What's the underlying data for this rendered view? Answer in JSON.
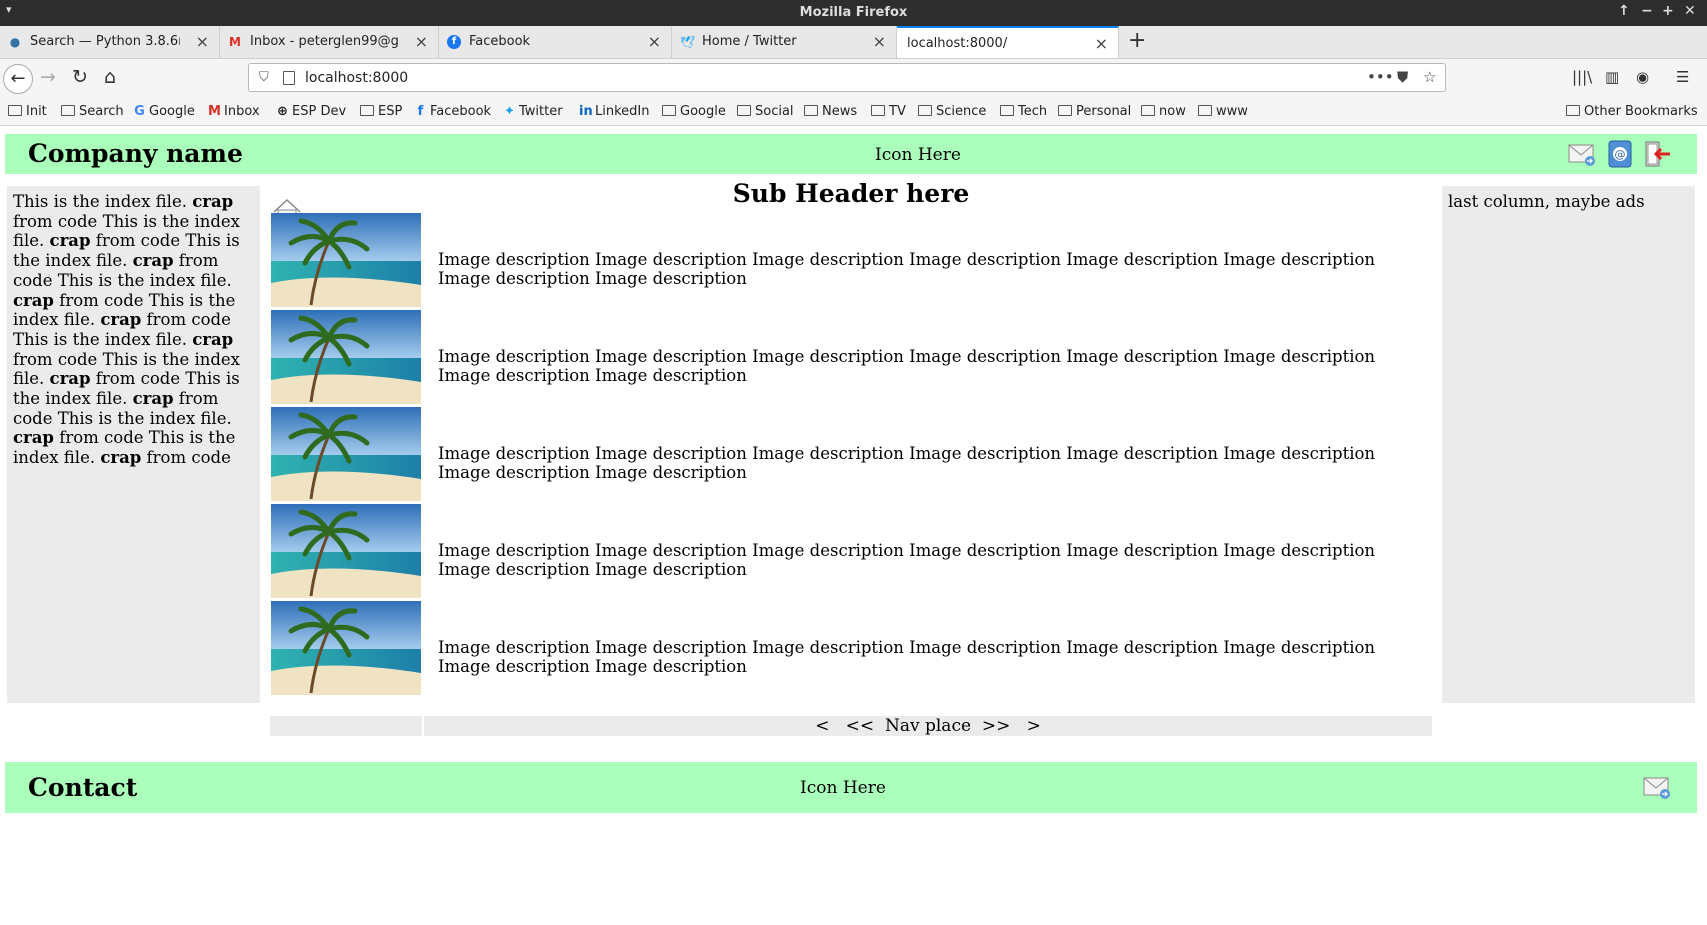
{
  "window": {
    "title": "Mozilla Firefox"
  },
  "tabs": [
    {
      "label": "Search — Python 3.8.6rc1 d",
      "icon": "python-icon",
      "active": false
    },
    {
      "label": "Inbox - peterglen99@gmail",
      "icon": "gmail-icon",
      "active": false
    },
    {
      "label": "Facebook",
      "icon": "facebook-icon",
      "active": false
    },
    {
      "label": "Home / Twitter",
      "icon": "twitter-icon",
      "active": false
    },
    {
      "label": "localhost:8000/",
      "icon": "",
      "active": true
    }
  ],
  "navbar": {
    "url": "localhost:8000"
  },
  "bookmarks": [
    {
      "label": "Init",
      "icon": "folder-icon"
    },
    {
      "label": "Search",
      "icon": "folder-icon"
    },
    {
      "label": "Google",
      "icon": "google-icon"
    },
    {
      "label": "Inbox",
      "icon": "gmail-icon"
    },
    {
      "label": "ESP Dev",
      "icon": "globe-icon"
    },
    {
      "label": "ESP",
      "icon": "folder-icon"
    },
    {
      "label": "Facebook",
      "icon": "facebook-icon"
    },
    {
      "label": "Twitter",
      "icon": "twitter-icon"
    },
    {
      "label": "LinkedIn",
      "icon": "linkedin-icon"
    },
    {
      "label": "Google",
      "icon": "folder-icon"
    },
    {
      "label": "Social",
      "icon": "folder-icon"
    },
    {
      "label": "News",
      "icon": "folder-icon"
    },
    {
      "label": "TV",
      "icon": "folder-icon"
    },
    {
      "label": "Science",
      "icon": "folder-icon"
    },
    {
      "label": "Tech",
      "icon": "folder-icon"
    },
    {
      "label": "Personal",
      "icon": "folder-icon"
    },
    {
      "label": "now",
      "icon": "folder-icon"
    },
    {
      "label": "www",
      "icon": "folder-icon"
    }
  ],
  "other_bookmarks": "Other Bookmarks",
  "page": {
    "header": {
      "company": "Company name",
      "icon_here": "Icon Here"
    },
    "left_text": {
      "normal": "This is the index file. ",
      "bold": "crap",
      "tail": " from code",
      "repeat": 10
    },
    "sub_header": "Sub Header here",
    "rows": [
      {
        "desc": "Image description Image description Image description Image description Image description Image description Image description Image description"
      },
      {
        "desc": "Image description Image description Image description Image description Image description Image description Image description Image description"
      },
      {
        "desc": "Image description Image description Image description Image description Image description Image description Image description Image description"
      },
      {
        "desc": "Image description Image description Image description Image description Image description Image description Image description Image description"
      },
      {
        "desc": "Image description Image description Image description Image description Image description Image description Image description Image description"
      }
    ],
    "nav": {
      "first": "<",
      "prev": "<<",
      "label": "Nav place",
      "next": ">>",
      "last": ">"
    },
    "right_col": "last column, maybe ads",
    "footer": {
      "contact": "Contact",
      "icon_here": "Icon Here"
    }
  },
  "colors": {
    "banner": "#aaffbb",
    "column_bg": "#ebebeb",
    "tab_accent": "#0a84ff"
  }
}
